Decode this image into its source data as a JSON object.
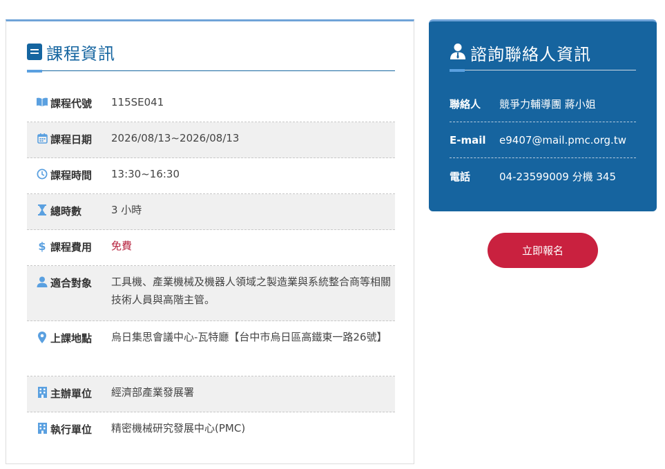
{
  "course_info": {
    "title": "課程資訊",
    "rows": [
      {
        "label": "課程代號",
        "value": "115SE041"
      },
      {
        "label": "課程日期",
        "value": "2026/08/13~2026/08/13"
      },
      {
        "label": "課程時間",
        "value": "13:30~16:30"
      },
      {
        "label": "總時數",
        "value": "3 小時"
      },
      {
        "label": "課程費用",
        "value": "免費"
      },
      {
        "label": "適合對象",
        "value": "工具機、產業機械及機器人領域之製造業與系統整合商等相關技術人員與高階主管。"
      },
      {
        "label": "上課地點",
        "value": "烏日集思會議中心-瓦特廳【台中市烏日區高鐵東一路26號】"
      },
      {
        "label": "主辦單位",
        "value": "經濟部產業發展署"
      },
      {
        "label": "執行單位",
        "value": "精密機械研究發展中心(PMC)"
      }
    ]
  },
  "contact": {
    "title": "諮詢聯絡人資訊",
    "rows": [
      {
        "label": "聯絡人",
        "value": "競爭力輔導團 蔣小姐"
      },
      {
        "label": "E-mail",
        "value": "e9407@mail.pmc.org.tw"
      },
      {
        "label": "電話",
        "value": "04-23599009 分機 345"
      }
    ]
  },
  "signup_button": "立即報名",
  "colors": {
    "primary": "#1565a0",
    "accent": "#5aa0e0",
    "fee": "#b7233f",
    "button": "#c9213f"
  }
}
